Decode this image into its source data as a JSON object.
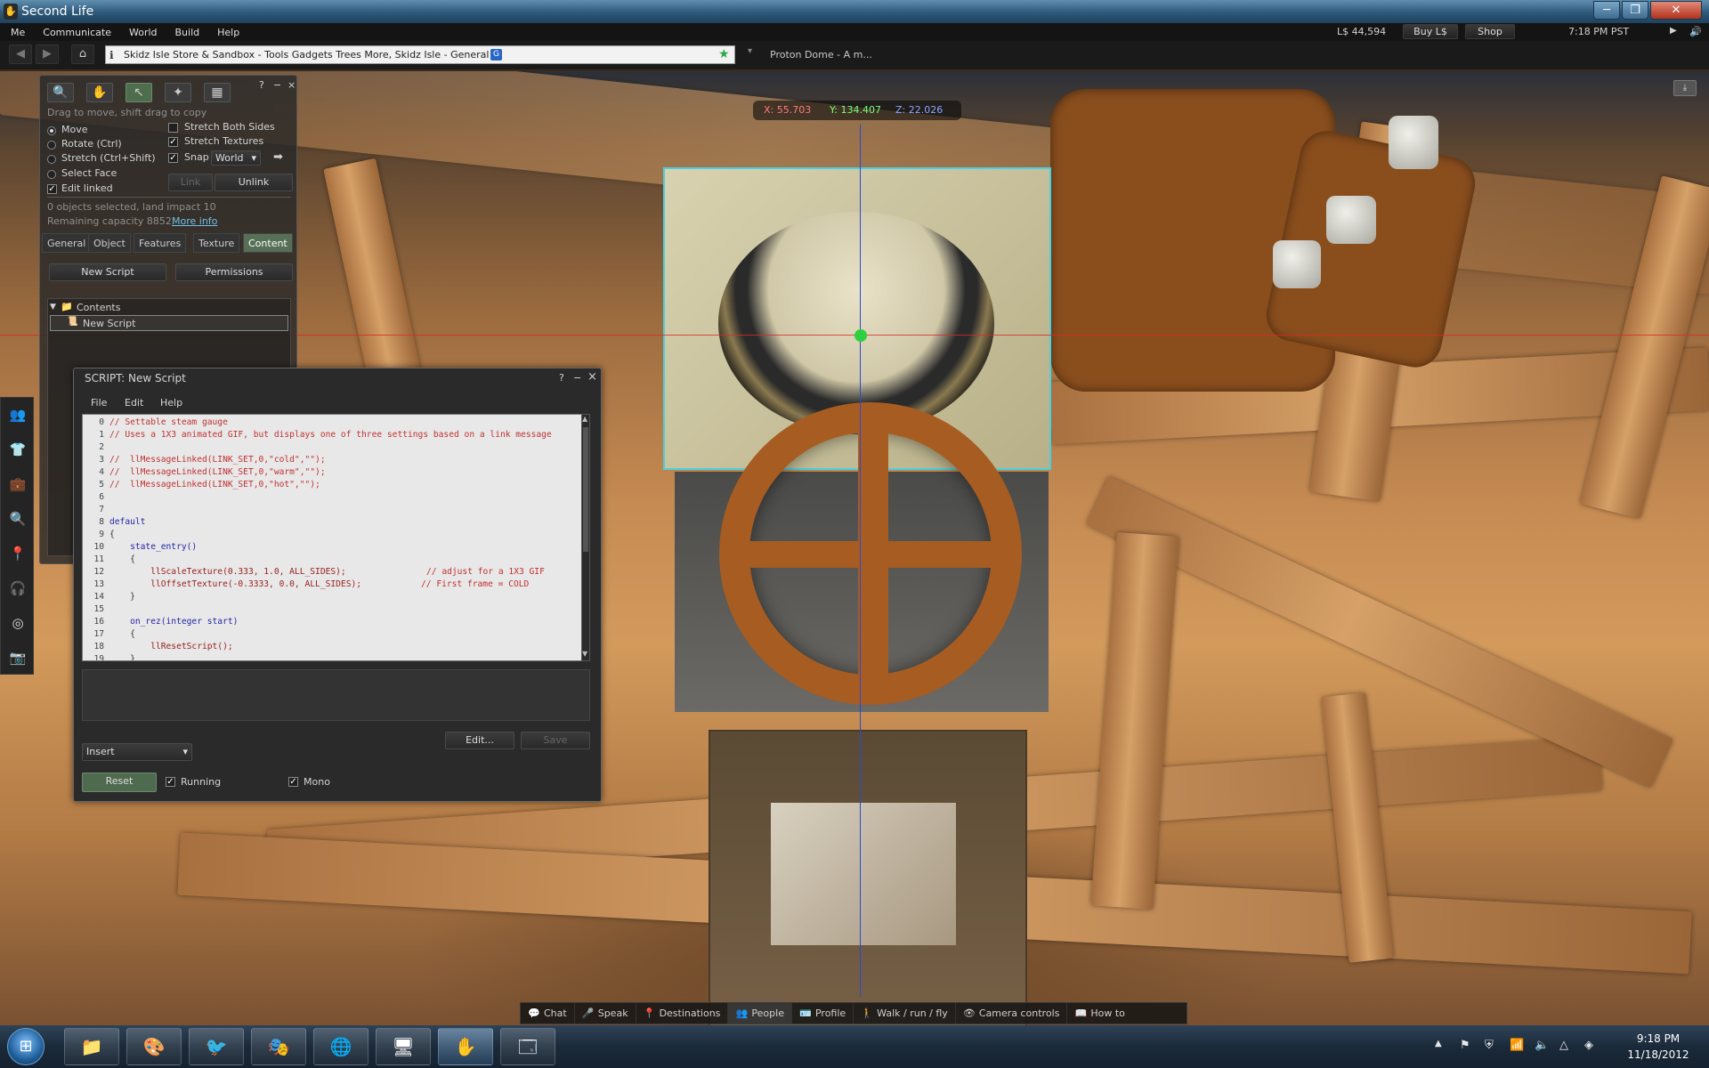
{
  "window": {
    "title": "Second Life",
    "buttons": [
      "─",
      "❐",
      "✕"
    ]
  },
  "menubar": {
    "items": [
      "Me",
      "Communicate",
      "World",
      "Build",
      "Help"
    ],
    "balance": "L$ 44,594",
    "buy_label": "Buy L$",
    "shop_label": "Shop",
    "time": "7:18 PM PST"
  },
  "navbar": {
    "location": "Skidz Isle Store & Sandbox - Tools Gadgets Trees More, Skidz Isle - General",
    "favorite": "Proton Dome - A m..."
  },
  "coords": {
    "x": "X: 55.703",
    "y": "Y: 134.407",
    "z": "Z: 22.026"
  },
  "build": {
    "hint": "Drag to move, shift drag to copy",
    "modes": [
      "Move",
      "Rotate (Ctrl)",
      "Stretch (Ctrl+Shift)",
      "Select Face"
    ],
    "edit_linked": "Edit linked",
    "stretch_both": "Stretch Both Sides",
    "stretch_textures": "Stretch Textures",
    "snap": "Snap",
    "snap_value": "World",
    "link": "Link",
    "unlink": "Unlink",
    "selected": "0 objects selected, land impact 10",
    "remaining": "Remaining capacity 8852",
    "more_info": "More info",
    "tabs": [
      "General",
      "Object",
      "Features",
      "Texture",
      "Content"
    ],
    "new_script": "New Script",
    "permissions": "Permissions",
    "folder": "Contents",
    "item": "New Script"
  },
  "script": {
    "title": "SCRIPT: New Script",
    "menu": [
      "File",
      "Edit",
      "Help"
    ],
    "insert": "Insert",
    "edit": "Edit...",
    "save": "Save",
    "reset": "Reset",
    "running": "Running",
    "mono": "Mono",
    "lines": [
      "// Settable steam gauge",
      "// Uses a 1X3 animated GIF, but displays one of three settings based on a link message",
      "",
      "//  llMessageLinked(LINK_SET,0,\"cold\",\"\");",
      "//  llMessageLinked(LINK_SET,0,\"warm\",\"\");",
      "//  llMessageLinked(LINK_SET,0,\"hot\",\"\");",
      "",
      "",
      "default",
      "{",
      "    state_entry()",
      "    {",
      "        llScaleTexture(0.333, 1.0, ALL_SIDES);",
      "        llOffsetTexture(-0.3333, 0.0, ALL_SIDES);",
      "    }",
      "",
      "    on_rez(integer start)",
      "    {",
      "        llResetScript();",
      "    }"
    ],
    "comment_12": "// adjust for a 1X3 GIF",
    "comment_13": "// First frame = COLD"
  },
  "bottombar": {
    "items": [
      "Chat",
      "Speak",
      "Destinations",
      "People",
      "Profile",
      "Walk / run / fly",
      "Camera controls",
      "How to"
    ]
  },
  "taskbar": {
    "time": "9:18 PM",
    "date": "11/18/2012"
  }
}
